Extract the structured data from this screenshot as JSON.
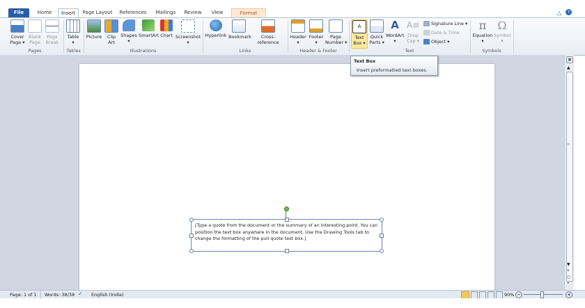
{
  "tabs": [
    {
      "label": "File"
    },
    {
      "label": "Home"
    },
    {
      "label": "Insert"
    },
    {
      "label": "Page Layout"
    },
    {
      "label": "References"
    },
    {
      "label": "Mailings"
    },
    {
      "label": "Review"
    },
    {
      "label": "View"
    },
    {
      "label": "Format"
    }
  ],
  "ribbon": {
    "pages": {
      "label": "Pages",
      "cover": "Cover\nPage ▾",
      "blank": "Blank\nPage",
      "break": "Page\nBreak"
    },
    "tables": {
      "label": "Tables",
      "table": "Table\n▾"
    },
    "illustrations": {
      "label": "Illustrations",
      "picture": "Picture",
      "clipart": "Clip\nArt",
      "shapes": "Shapes\n▾",
      "smartart": "SmartArt",
      "chart": "Chart",
      "screenshot": "Screenshot\n▾"
    },
    "links": {
      "label": "Links",
      "hyperlink": "Hyperlink",
      "bookmark": "Bookmark",
      "crossref": "Cross-reference"
    },
    "header_footer": {
      "label": "Header & Footer",
      "header": "Header\n▾",
      "footer": "Footer\n▾",
      "pagenumber": "Page\nNumber ▾"
    },
    "text": {
      "label": "Text",
      "textbox": "Text\nBox ▾",
      "quickparts": "Quick\nParts ▾",
      "wordart": "WordArt\n▾",
      "dropcap": "Drop\nCap ▾",
      "signature": "Signature Line ▾",
      "datetime": "Date & Time",
      "object": "Object ▾"
    },
    "symbols": {
      "label": "Symbols",
      "equation": "Equation\n▾",
      "symbol": "Symbol\n▾"
    }
  },
  "tooltip": {
    "title": "Text Box",
    "body": "Insert preformatted text boxes."
  },
  "document": {
    "textbox_text": "[Type a quote from the document or the summary of an interesting point. You can position the text box anywhere in the document. Use the Drawing Tools tab to change the formatting of the pull quote text box.]"
  },
  "status": {
    "page": "Page: 1 of 1",
    "words": "Words: 38/38",
    "language": "English (India)",
    "zoom": "90%"
  },
  "icons": [
    "help-icon",
    "cover-page-icon",
    "table-icon",
    "picture-icon",
    "hyperlink-icon",
    "textbox-icon",
    "equation-icon",
    "symbol-icon"
  ]
}
